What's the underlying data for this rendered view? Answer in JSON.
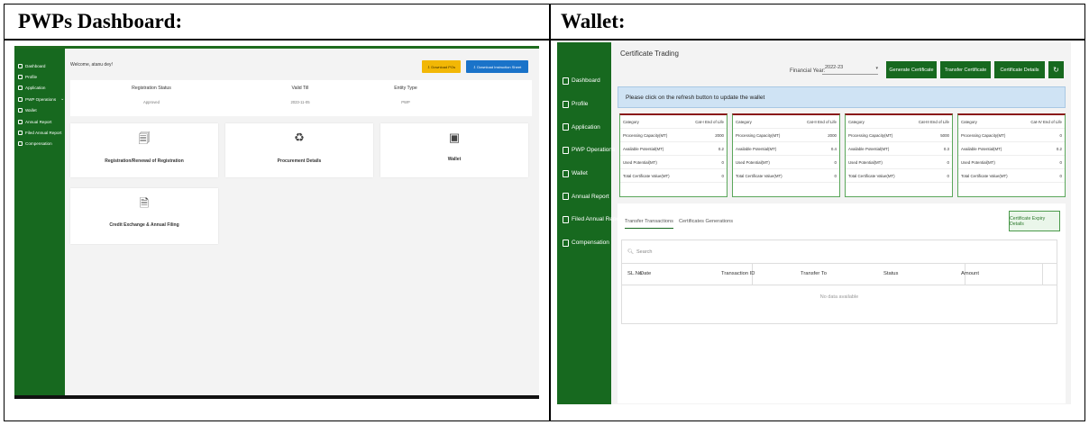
{
  "headings": {
    "left": "PWPs Dashboard:",
    "right": "Wallet:"
  },
  "left": {
    "sidebar": [
      {
        "label": "Dashboard",
        "icon": "dashboard-icon"
      },
      {
        "label": "Profile",
        "icon": "user-icon"
      },
      {
        "label": "Application",
        "icon": "application-icon"
      },
      {
        "label": "PWP Operations",
        "icon": "operations-icon",
        "chevron": "⌄"
      },
      {
        "label": "Wallet",
        "icon": "wallet-icon"
      },
      {
        "label": "Annual Report",
        "icon": "report-icon"
      },
      {
        "label": "Filed Annual Report",
        "icon": "filed-report-icon"
      },
      {
        "label": "Compensation",
        "icon": "compensation-icon"
      }
    ],
    "welcome": "Welcome, atanu dey!",
    "buttons": {
      "download_pos": "⇩ Download POs",
      "download_instruction": "⇩ Download Instruction Sheet"
    },
    "registration": {
      "status_label": "Registration Status",
      "status_value": "Approved",
      "valid_label": "Valid Till",
      "valid_value": "2023-11-05",
      "entity_label": "Entity Type",
      "entity_value": "PWP"
    },
    "tiles": {
      "registration": "Registration/Renewal of Registration",
      "procurement": "Procurement Details",
      "wallet": "Wallet",
      "credit": "Credit Exchange & Annual Filing"
    }
  },
  "right": {
    "sidebar": [
      {
        "label": "Dashboard",
        "icon": "dashboard-icon"
      },
      {
        "label": "Profile",
        "icon": "user-icon"
      },
      {
        "label": "Application",
        "icon": "application-icon"
      },
      {
        "label": "PWP Operations",
        "icon": "operations-icon",
        "chevron": "⌄"
      },
      {
        "label": "Wallet",
        "icon": "wallet-icon"
      },
      {
        "label": "Annual Report",
        "icon": "report-icon"
      },
      {
        "label": "Filed Annual Report",
        "icon": "filed-report-icon"
      },
      {
        "label": "Compensation",
        "icon": "compensation-icon"
      }
    ],
    "title": "Certificate Trading",
    "financial_year_label": "Financial Year:",
    "financial_year_value": "2022-23",
    "buttons": {
      "generate": "Generate Certificate",
      "transfer": "Transfer Certificate",
      "details": "Certificate Details",
      "refresh": "↻"
    },
    "banner": "Please click on the refresh button to update the wallet",
    "cards": [
      {
        "rows": [
          [
            "Category",
            "Cat-I End of Life"
          ],
          [
            "Processing Capacity(MT)",
            "2000"
          ],
          [
            "Available Potential(MT)",
            "0.2"
          ],
          [
            "Used Potential(MT)",
            "0"
          ],
          [
            "Total Certificate Value(MT)",
            "0"
          ]
        ]
      },
      {
        "rows": [
          [
            "Category",
            "Cat-II End of Life"
          ],
          [
            "Processing Capacity(MT)",
            "2000"
          ],
          [
            "Available Potential(MT)",
            "0.4"
          ],
          [
            "Used Potential(MT)",
            "0"
          ],
          [
            "Total Certificate Value(MT)",
            "0"
          ]
        ]
      },
      {
        "rows": [
          [
            "Category",
            "Cat-III End of Life"
          ],
          [
            "Processing Capacity(MT)",
            "5000"
          ],
          [
            "Available Potential(MT)",
            "0.3"
          ],
          [
            "Used Potential(MT)",
            "0"
          ],
          [
            "Total Certificate Value(MT)",
            "0"
          ]
        ]
      },
      {
        "rows": [
          [
            "Category",
            "Cat-IV End of Life"
          ],
          [
            "Processing Capacity(MT)",
            "0"
          ],
          [
            "Available Potential(MT)",
            "0.2"
          ],
          [
            "Used Potential(MT)",
            "0"
          ],
          [
            "Total Certificate Value(MT)",
            "0"
          ]
        ]
      }
    ],
    "tabs": {
      "transfer": "Transfer Transactions",
      "generation": "Certificates Generations"
    },
    "expiry_button": "Certificate Expiry Details",
    "search_placeholder": "Search",
    "columns": [
      "SL.No",
      "Date",
      "Transaction ID",
      "Transfer To",
      "Status",
      "Amount"
    ],
    "empty": "No data available"
  }
}
